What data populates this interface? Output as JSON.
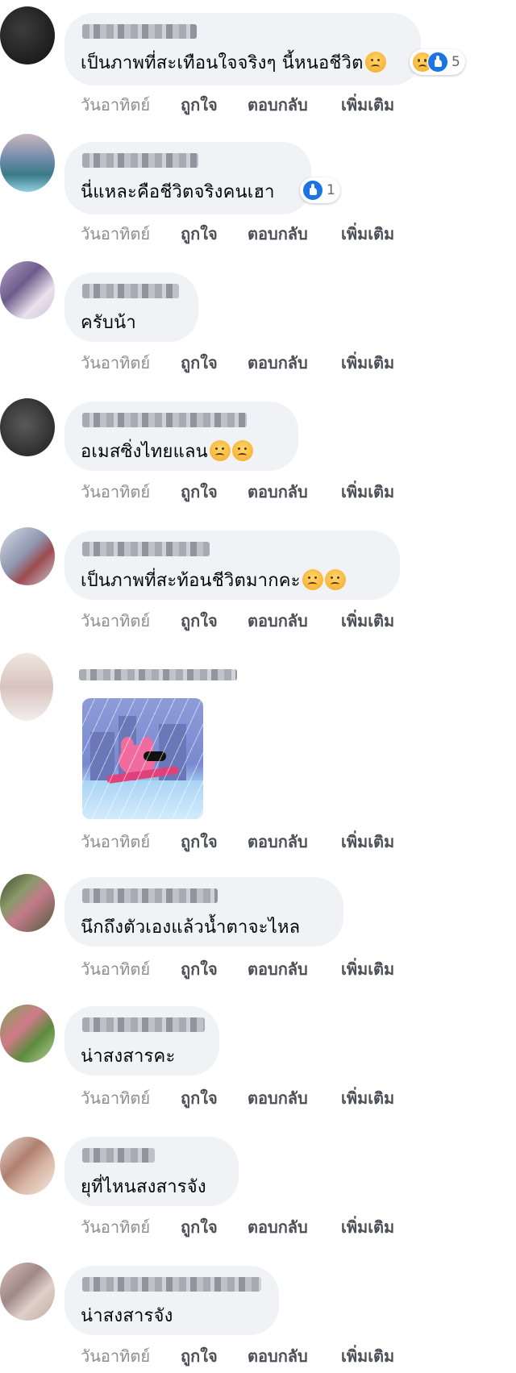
{
  "actions": {
    "time": "วันอาทิตย์",
    "like": "ถูกใจ",
    "reply": "ตอบกลับ",
    "more": "เพิ่มเติม"
  },
  "comments": [
    {
      "text": "เป็นภาพที่สะเทือนใจจริงๆ นี้หนอชีวิต",
      "reaction_count": "5",
      "reactions": [
        "sad-reaction-icon",
        "like-reaction-icon"
      ]
    },
    {
      "text": "นี่แหละคือชีวิตจริงคนเฮา",
      "reaction_count": "1",
      "reactions": [
        "like-reaction-icon"
      ]
    },
    {
      "text": "ครับน้า"
    },
    {
      "text": "อเมสซิ่งไทยแลน",
      "emoji": [
        "disappointed-emoji-icon",
        "thinking-emoji-icon"
      ]
    },
    {
      "text": "เป็นภาพที่สะท้อนชีวิตมากคะ",
      "emoji": [
        "sad-emoji-icon",
        "sad-emoji-icon"
      ]
    },
    {
      "sticker": "pig-swimming-in-rain-sticker"
    },
    {
      "text": "นึกถึงตัวเองแล้วน้ำตาจะไหล"
    },
    {
      "text": "น่าสงสารคะ"
    },
    {
      "text": "ยุที่ไหนสงสารจัง"
    },
    {
      "text": "น่าสงสารจัง"
    }
  ],
  "colors": {
    "bubble": "#f0f2f5",
    "text": "#050505",
    "meta": "#8a8d91",
    "action": "#4b4f56",
    "like_blue": "#1b74e4"
  }
}
